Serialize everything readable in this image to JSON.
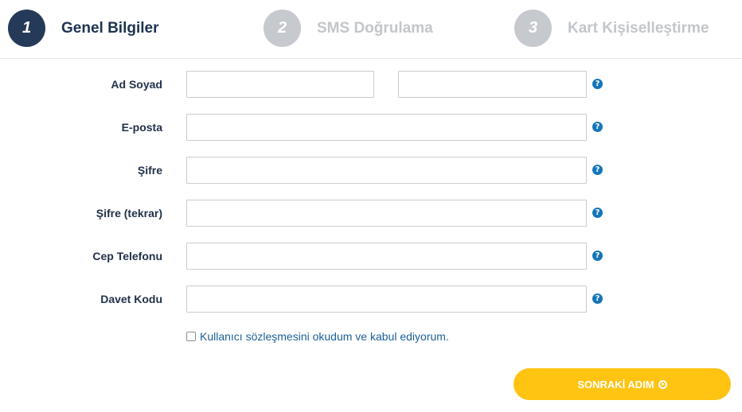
{
  "steps": [
    {
      "number": "1",
      "label": "Genel Bilgiler",
      "state": "active"
    },
    {
      "number": "2",
      "label": "SMS Doğrulama",
      "state": "inactive"
    },
    {
      "number": "3",
      "label": "Kart Kişiselleştirme",
      "state": "inactive"
    }
  ],
  "form": {
    "fields": [
      {
        "label": "Ad Soyad",
        "value_first": "",
        "value_last": ""
      },
      {
        "label": "E-posta",
        "value": ""
      },
      {
        "label": "Şifre",
        "value": ""
      },
      {
        "label": "Şifre (tekrar)",
        "value": ""
      },
      {
        "label": "Cep Telefonu",
        "value": ""
      },
      {
        "label": "Davet Kodu",
        "value": ""
      }
    ],
    "help_icon_glyph": "?",
    "agreement": {
      "text": "Kullanıcı sözleşmesini okudum ve kabul ediyorum",
      "suffix": ".",
      "checked": false
    }
  },
  "next_button": {
    "label": "SONRAKİ ADIM"
  },
  "colors": {
    "active_step": "#253a58",
    "inactive_step": "#c6c9cd",
    "help_icon": "#1576b8",
    "button": "#ffc312",
    "link": "#1b5f98"
  },
  "icons": [
    "help-icon",
    "arrow-circle-right-icon",
    "checkbox-icon"
  ]
}
